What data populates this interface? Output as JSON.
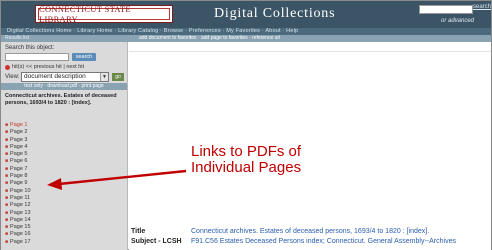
{
  "header": {
    "logo_text": "CONNECTICUT STATE LIBRARY",
    "title": "Digital Collections",
    "search_button": "search",
    "advanced_link": "or advanced"
  },
  "nav": {
    "text": "Digital Collections Home · Library Home · Library Catalog · Browse · Preferences · My Favorites · About · Help"
  },
  "subbar": {
    "left": "Results list",
    "actions": "add document to favorites · add page to favorites · reference url"
  },
  "sidebar": {
    "search_label": "Search this object:",
    "search_button": "search",
    "hits_text": "hit(s) << previous hit | next hit",
    "view_label": "View:",
    "view_value": "document description",
    "view_arrow": "▼",
    "go_label": "go",
    "download_links": "text only · download pdf · print page",
    "doc_title": "Connecticut archives. Estates of deceased persons, 1693/4 to 1820 : [index].",
    "pages": [
      "Page 1",
      "Page 2",
      "Page 3",
      "Page 4",
      "Page 5",
      "Page 6",
      "Page 7",
      "Page 8",
      "Page 9",
      "Page 10",
      "Page 11",
      "Page 12",
      "Page 13",
      "Page 14",
      "Page 15",
      "Page 16",
      "Page 17"
    ]
  },
  "annotation": {
    "line1": "Links to PDFs of",
    "line2": "Individual Pages"
  },
  "metadata": {
    "title_label": "Title",
    "title_value": "Connecticut archives. Estates of deceased persons, 1693/4 to 1820 : [index].",
    "subject_label": "Subject - LCSH",
    "subject_value": "F91.C56 Estates Deceased Persons index; Connecticut. General Assembly--Archives"
  },
  "colors": {
    "header_bg": "#3b5567",
    "nav_bg": "#4c6a7d",
    "subbar_bg": "#8aa3b3",
    "sidebar_bg": "#dadada",
    "annotation": "#c00000",
    "link": "#2a5db0"
  },
  "icons": {
    "page_link": "page-pdf-icon",
    "hit_marker": "red-dot-icon",
    "annotation_arrow": "arrow-left-icon"
  }
}
